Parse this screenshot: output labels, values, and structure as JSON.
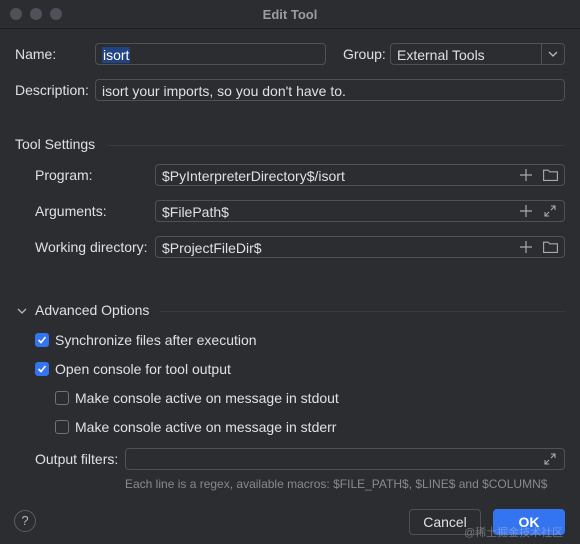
{
  "window": {
    "title": "Edit Tool"
  },
  "name": {
    "label": "Name:",
    "value": "isort"
  },
  "group": {
    "label": "Group:",
    "value": "External Tools"
  },
  "description": {
    "label": "Description:",
    "value": "isort your imports, so you don't have to."
  },
  "tool_settings": {
    "heading": "Tool Settings",
    "program": {
      "label": "Program:",
      "value": "$PyInterpreterDirectory$/isort"
    },
    "arguments": {
      "label": "Arguments:",
      "value": "$FilePath$"
    },
    "working_directory": {
      "label": "Working directory:",
      "value": "$ProjectFileDir$"
    }
  },
  "advanced": {
    "heading": "Advanced Options",
    "sync_files": {
      "label": "Synchronize files after execution",
      "checked": true
    },
    "open_console": {
      "label": "Open console for tool output",
      "checked": true
    },
    "stdout": {
      "label": "Make console active on message in stdout",
      "checked": false
    },
    "stderr": {
      "label": "Make console active on message in stderr",
      "checked": false
    },
    "output_filters": {
      "label": "Output filters:",
      "value": "",
      "hint": "Each line is a regex, available macros: $FILE_PATH$, $LINE$ and $COLUMN$"
    }
  },
  "buttons": {
    "help": "?",
    "cancel": "Cancel",
    "ok": "OK"
  },
  "watermark": "@稀土掘金技术社区",
  "colors": {
    "accent": "#3574f0",
    "background": "#2b2d30",
    "selection": "#214283"
  }
}
